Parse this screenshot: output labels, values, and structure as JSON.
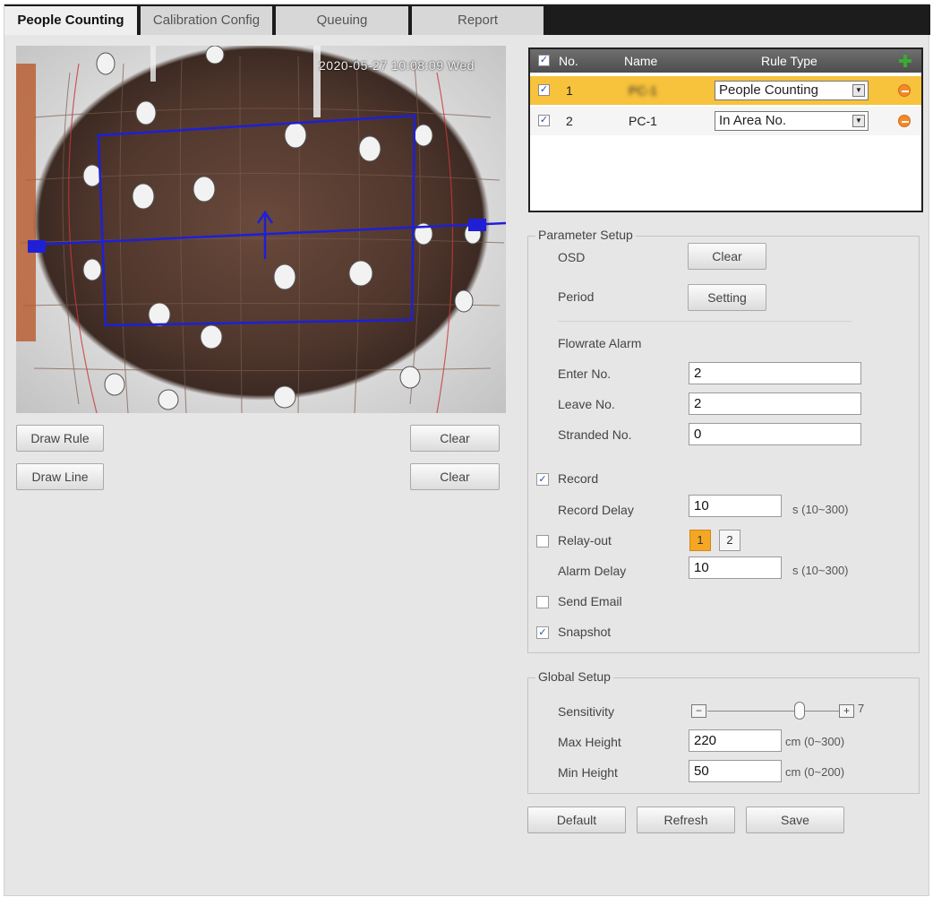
{
  "tabs": [
    {
      "label": "People Counting",
      "active": true
    },
    {
      "label": "Calibration Config",
      "active": false
    },
    {
      "label": "Queuing",
      "active": false
    },
    {
      "label": "Report",
      "active": false
    }
  ],
  "video": {
    "timestamp": "2020-05-27 10:08:09 Wed"
  },
  "video_controls": {
    "draw_rule": "Draw Rule",
    "draw_line": "Draw Line",
    "clear_rule": "Clear",
    "clear_line": "Clear"
  },
  "rule_table": {
    "headers": {
      "no": "No.",
      "name": "Name",
      "rule_type": "Rule Type"
    },
    "rows": [
      {
        "no": "1",
        "name": "PC-1",
        "rule_type": "People Counting",
        "checked": true,
        "selected": true
      },
      {
        "no": "2",
        "name": "PC-1",
        "rule_type": "In Area No.",
        "checked": true,
        "selected": false
      }
    ]
  },
  "parameter_setup": {
    "title": "Parameter Setup",
    "osd_label": "OSD",
    "osd_button": "Clear",
    "period_label": "Period",
    "period_button": "Setting",
    "flowrate_alarm": "Flowrate Alarm",
    "enter_label": "Enter No.",
    "enter_value": "2",
    "leave_label": "Leave No.",
    "leave_value": "2",
    "stranded_label": "Stranded No.",
    "stranded_value": "0",
    "record_label": "Record",
    "record_checked": true,
    "record_delay_label": "Record Delay",
    "record_delay_value": "10",
    "record_delay_unit": "s (10~300)",
    "relay_label": "Relay-out",
    "relay_checked": false,
    "relay_options": [
      "1",
      "2"
    ],
    "alarm_delay_label": "Alarm Delay",
    "alarm_delay_value": "10",
    "alarm_delay_unit": "s (10~300)",
    "send_email_label": "Send Email",
    "send_email_checked": false,
    "snapshot_label": "Snapshot",
    "snapshot_checked": true
  },
  "global_setup": {
    "title": "Global Setup",
    "sensitivity_label": "Sensitivity",
    "sensitivity_value": "7",
    "sensitivity_level": 0.7,
    "max_height_label": "Max Height",
    "max_height_value": "220",
    "max_height_unit": "cm (0~300)",
    "min_height_label": "Min Height",
    "min_height_value": "50",
    "min_height_unit": "cm (0~200)"
  },
  "footer": {
    "default": "Default",
    "refresh": "Refresh",
    "save": "Save"
  },
  "colors": {
    "rule_overlay": "#1f1fd6",
    "selected_row": "#f7c23c",
    "add_icon": "#3aaa35",
    "remove_icon": "#f28a2a",
    "relay_active": "#f5a623"
  }
}
